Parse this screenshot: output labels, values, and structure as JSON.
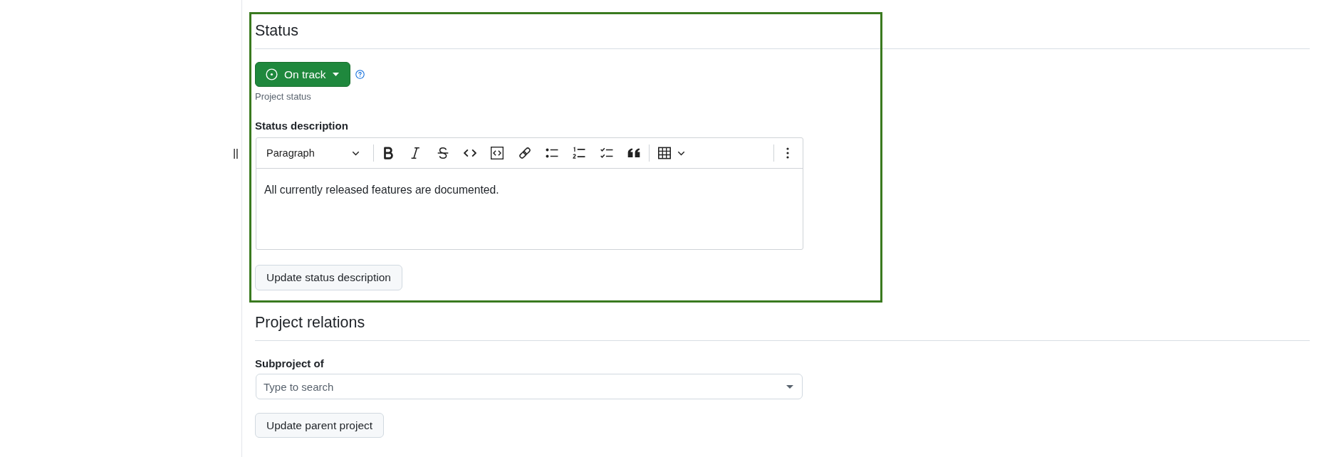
{
  "status": {
    "highlighted": true,
    "heading": "Status",
    "status_button": {
      "label": "On track"
    },
    "caption": "Project status",
    "description_label": "Status description",
    "editor": {
      "block_format": "Paragraph",
      "content": "All currently released features are documented."
    },
    "submit_button": "Update status description"
  },
  "relations": {
    "heading": "Project relations",
    "field_label": "Subproject of",
    "field": {
      "placeholder": "Type to search"
    },
    "submit_button": "Update parent project"
  }
}
